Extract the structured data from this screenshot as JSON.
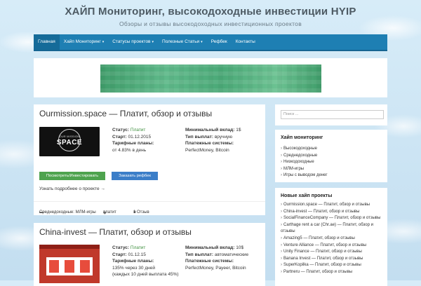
{
  "site": {
    "title": "ХАЙП Мониторинг, высокодоходные инвестиции HYIP",
    "description": "Обзоры и отзывы высокодоходных инвестиционных проектов"
  },
  "nav": {
    "items": [
      {
        "label": "Главная",
        "active": true
      },
      {
        "label": "Хайп Мониторинг",
        "dropdown": true
      },
      {
        "label": "Статусы проектов",
        "dropdown": true
      },
      {
        "label": "Полезные Статьи",
        "dropdown": true
      },
      {
        "label": "Рефбек"
      },
      {
        "label": "Контакты"
      }
    ],
    "caret": "▾",
    "color": "#1e7fb3"
  },
  "posts": [
    {
      "title": "Ourmission.space — Платит, обзор и отзывы",
      "thumb_small": "OUR MISSION",
      "thumb_big": "SPACE",
      "status_label": "Статус:",
      "status_value": "Платит",
      "start_label": "Старт:",
      "start_value": "01.12.2015",
      "plans_label": "Тарифные планы:",
      "plans_value": "от 4.83% в день",
      "min_label": "Минимальный вклад:",
      "min_value": "1$",
      "payout_label": "Тип выплат:",
      "payout_value": "вручную",
      "systems_label": "Платежные системы:",
      "systems_value": "PerfectMoney, Bitcoin",
      "btn_invest": "Посмотреть/Инвестировать",
      "btn_refback": "Заказать рефбек",
      "more": "Узнать подробнее о проекте →",
      "category": "Среднедоходные: МЛМ-игры",
      "tag": "платит",
      "comments": "1 Отзыв"
    },
    {
      "title": "China-invest — Платит, обзор и отзывы",
      "status_label": "Статус:",
      "status_value": "Платит",
      "start_label": "Старт:",
      "start_value": "01.12.15",
      "plans_label": "Тарифные планы:",
      "plans_value_1": "135% через 30 дней",
      "plans_value_2": "(каждых 10 дней выплата 45%)",
      "min_label": "Минимальный вклад:",
      "min_value": "10$",
      "payout_label": "Тип выплат:",
      "payout_value": "автоматические",
      "systems_label": "Платежные системы:",
      "systems_value": "PerfectMoney, Payeer, Bitcoin"
    }
  ],
  "sidebar": {
    "search_placeholder": "Поиск ...",
    "hype_title": "Хайп мониторинг",
    "hype_items": [
      "Высокодоходные",
      "Среднедоходные",
      "Низкодоходные",
      "МЛМ-игры",
      "Игры с выводом денег"
    ],
    "new_title": "Новые хайп проекты",
    "new_items": [
      "Ourmission.space — Платит, обзор и отзывы",
      "China-invest — Платит, обзор и отзывы",
      "SocialFinanceCompany — Платит, обзор и отзывы",
      "Carthage rent a car (Chr.ae) — Платит, обзор и отзывы",
      "Amazing5 — Платит, обзор и отзывы",
      "Venture Alliance — Платит, обзор и отзывы",
      "Unity Finance — Платит, обзор и отзывы",
      "Banana Invest — Платит, обзор и отзывы",
      "SuperKopilka — Платит, обзор и отзывы",
      "Partneru — Платит, обзор и отзывы"
    ],
    "chevron": "›"
  },
  "icons": {
    "folder": "folder-icon",
    "tag": "tag-icon",
    "comment": "comment-icon"
  }
}
